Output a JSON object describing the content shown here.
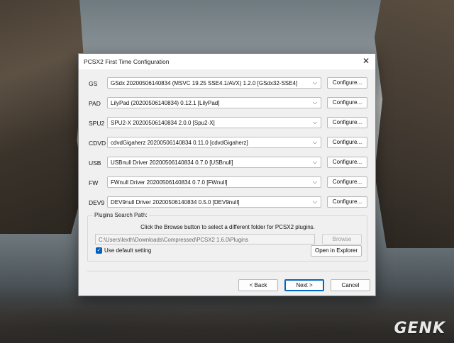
{
  "dialog": {
    "title": "PCSX2 First Time Configuration",
    "close_label": "✕"
  },
  "plugins": [
    {
      "label": "GS",
      "value": "GSdx 20200506140834 (MSVC 19.25 SSE4.1/AVX) 1.2.0 [GSdx32-SSE4]",
      "configure": "Configure..."
    },
    {
      "label": "PAD",
      "value": "LilyPad (20200506140834) 0.12.1 [LilyPad]",
      "configure": "Configure..."
    },
    {
      "label": "SPU2",
      "value": "SPU2-X 20200506140834 2.0.0 [Spu2-X]",
      "configure": "Configure..."
    },
    {
      "label": "CDVD",
      "value": "cdvdGigaherz 20200506140834 0.11.0 [cdvdGigaherz]",
      "configure": "Configure..."
    },
    {
      "label": "USB",
      "value": "USBnull Driver 20200506140834 0.7.0 [USBnull]",
      "configure": "Configure..."
    },
    {
      "label": "FW",
      "value": "FWnull Driver 20200506140834 0.7.0 [FWnull]",
      "configure": "Configure..."
    },
    {
      "label": "DEV9",
      "value": "DEV9null Driver 20200506140834 0.5.0 [DEV9null]",
      "configure": "Configure..."
    }
  ],
  "search_path": {
    "group_title": "Plugins Search Path:",
    "hint": "Click the Browse button to select a different folder for PCSX2 plugins.",
    "path": "C:\\Users\\lexth\\Downloads\\Compressed\\PCSX2 1.6.0\\Plugins",
    "browse_label": "Browse",
    "default_checked": true,
    "default_label": "Use default setting",
    "explorer_label": "Open in Explorer"
  },
  "footer": {
    "back_label": "< Back",
    "next_label": "Next >",
    "cancel_label": "Cancel"
  },
  "watermark": {
    "text": "GENK"
  }
}
